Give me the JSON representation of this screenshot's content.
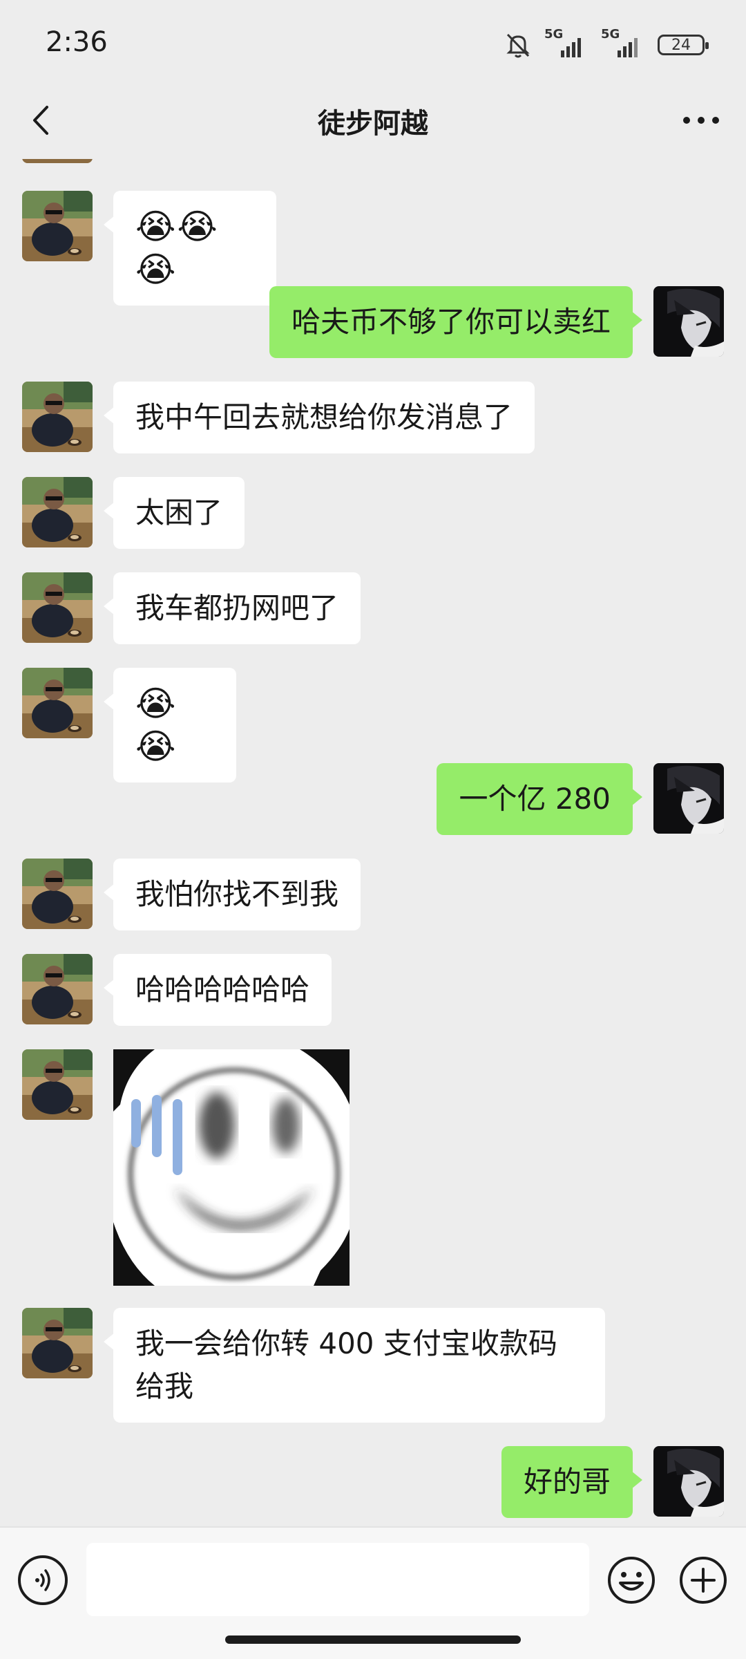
{
  "status_bar": {
    "time": "2:36",
    "network_1": "5G",
    "network_2": "5G",
    "battery": "24"
  },
  "header": {
    "title": "徒步阿越"
  },
  "messages": [
    {
      "side": "left",
      "kind": "emoji",
      "text": "😭😭😭"
    },
    {
      "side": "right",
      "kind": "text",
      "text": "哈夫币不够了你可以卖红"
    },
    {
      "side": "left",
      "kind": "text",
      "text": "我中午回去就想给你发消息了"
    },
    {
      "side": "left",
      "kind": "text",
      "text": "太困了"
    },
    {
      "side": "left",
      "kind": "text",
      "text": "我车都扔网吧了"
    },
    {
      "side": "left",
      "kind": "emoji",
      "text": "😭😭"
    },
    {
      "side": "right",
      "kind": "text",
      "text": "一个亿 280"
    },
    {
      "side": "left",
      "kind": "text",
      "text": "我怕你找不到我"
    },
    {
      "side": "left",
      "kind": "text",
      "text": "哈哈哈哈哈哈"
    },
    {
      "side": "left",
      "kind": "sticker",
      "text": ""
    },
    {
      "side": "left",
      "kind": "text",
      "text": "我一会给你转 400 支付宝收款码给我"
    },
    {
      "side": "right",
      "kind": "text",
      "text": "好的哥"
    }
  ],
  "input_bar": {
    "placeholder": "",
    "value": ""
  },
  "colors": {
    "background": "#ededed",
    "outgoing_bubble": "#95ec69",
    "incoming_bubble": "#ffffff"
  },
  "icons": {
    "back": "chevron-left-icon",
    "more": "more-dots-icon",
    "voice": "voice-icon",
    "emoji": "emoji-icon",
    "plus": "plus-icon"
  }
}
